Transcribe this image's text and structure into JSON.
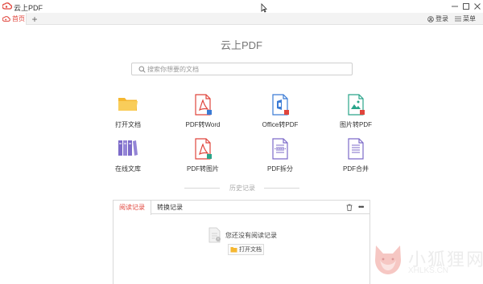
{
  "window": {
    "title": "云上PDF",
    "controls": [
      "minimize-icon",
      "maximize-icon",
      "close-icon"
    ]
  },
  "tabbar": {
    "home_tab": "首页",
    "add_tab": "+",
    "login": "登录",
    "menu": "菜单"
  },
  "main": {
    "title": "云上PDF",
    "search_placeholder": "搜索你想要的文档"
  },
  "tools": [
    {
      "label": "打开文档",
      "icon": "folder-icon"
    },
    {
      "label": "PDF转Word",
      "icon": "pdf-icon"
    },
    {
      "label": "Office转PDF",
      "icon": "office-icon"
    },
    {
      "label": "图片转PDF",
      "icon": "image-icon"
    },
    {
      "label": "在线文库",
      "icon": "library-icon"
    },
    {
      "label": "PDF转图片",
      "icon": "pdf-image-icon"
    },
    {
      "label": "PDF拆分",
      "icon": "pdf-split-icon"
    },
    {
      "label": "PDF合并",
      "icon": "pdf-merge-icon"
    }
  ],
  "history": {
    "title": "历史记录",
    "tabs": [
      "阅读记录",
      "转换记录"
    ],
    "empty_text": "您还没有阅读记录",
    "open_button": "打开文档"
  },
  "watermark": {
    "title": "小狐狸网",
    "url": "XHLKS.CN"
  },
  "colors": {
    "accent": "#e0453c",
    "folder": "#f5b731",
    "office": "#3a7bd5",
    "image": "#2aa58a",
    "library": "#7d6bc9"
  }
}
